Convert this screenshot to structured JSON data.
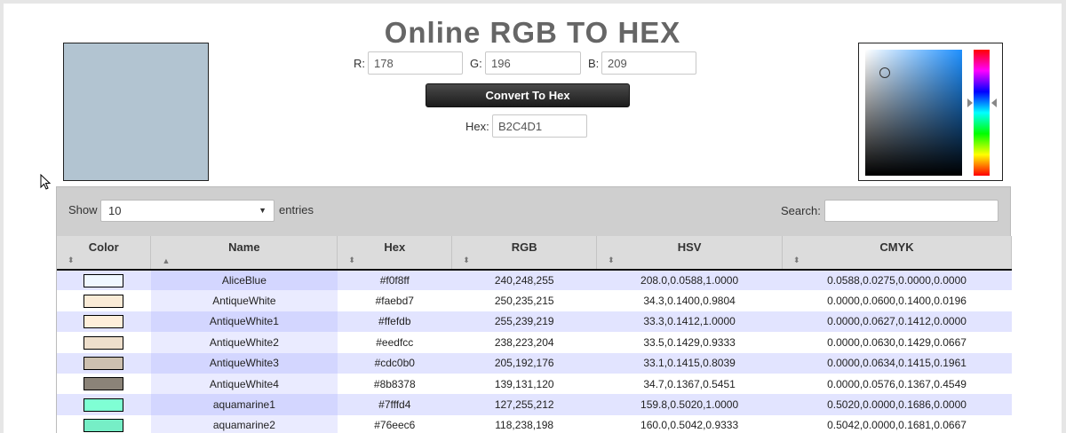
{
  "title": "Online RGB TO HEX",
  "preview_color": "#b2c4d1",
  "converter": {
    "r_label": "R:",
    "r_value": "178",
    "g_label": "G:",
    "g_value": "196",
    "b_label": "B:",
    "b_value": "209",
    "convert_label": "Convert To Hex",
    "hex_label": "Hex:",
    "hex_value": "B2C4D1"
  },
  "table_controls": {
    "show_label": "Show",
    "entries_value": "10",
    "entries_label": "entries",
    "search_label": "Search:"
  },
  "columns": [
    "Color",
    "Name",
    "Hex",
    "RGB",
    "HSV",
    "CMYK"
  ],
  "rows": [
    {
      "swatch": "#f0f8ff",
      "name": "AliceBlue",
      "hex": "#f0f8ff",
      "rgb": "240,248,255",
      "hsv": "208.0,0.0588,1.0000",
      "cmyk": "0.0588,0.0275,0.0000,0.0000"
    },
    {
      "swatch": "#faebd7",
      "name": "AntiqueWhite",
      "hex": "#faebd7",
      "rgb": "250,235,215",
      "hsv": "34.3,0.1400,0.9804",
      "cmyk": "0.0000,0.0600,0.1400,0.0196"
    },
    {
      "swatch": "#ffefdb",
      "name": "AntiqueWhite1",
      "hex": "#ffefdb",
      "rgb": "255,239,219",
      "hsv": "33.3,0.1412,1.0000",
      "cmyk": "0.0000,0.0627,0.1412,0.0000"
    },
    {
      "swatch": "#eedfcc",
      "name": "AntiqueWhite2",
      "hex": "#eedfcc",
      "rgb": "238,223,204",
      "hsv": "33.5,0.1429,0.9333",
      "cmyk": "0.0000,0.0630,0.1429,0.0667"
    },
    {
      "swatch": "#cdc0b0",
      "name": "AntiqueWhite3",
      "hex": "#cdc0b0",
      "rgb": "205,192,176",
      "hsv": "33.1,0.1415,0.8039",
      "cmyk": "0.0000,0.0634,0.1415,0.1961"
    },
    {
      "swatch": "#8b8378",
      "name": "AntiqueWhite4",
      "hex": "#8b8378",
      "rgb": "139,131,120",
      "hsv": "34.7,0.1367,0.5451",
      "cmyk": "0.0000,0.0576,0.1367,0.4549"
    },
    {
      "swatch": "#7fffd4",
      "name": "aquamarine1",
      "hex": "#7fffd4",
      "rgb": "127,255,212",
      "hsv": "159.8,0.5020,1.0000",
      "cmyk": "0.5020,0.0000,0.1686,0.0000"
    },
    {
      "swatch": "#76eec6",
      "name": "aquamarine2",
      "hex": "#76eec6",
      "rgb": "118,238,198",
      "hsv": "160.0,0.5042,0.9333",
      "cmyk": "0.5042,0.0000,0.1681,0.0667"
    }
  ]
}
